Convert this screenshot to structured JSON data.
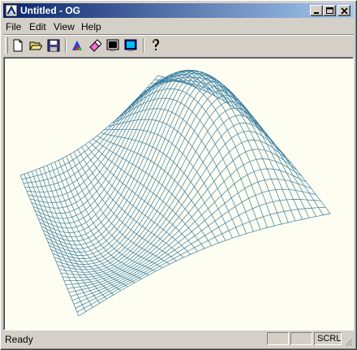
{
  "window": {
    "title": "Untitled - OG"
  },
  "menu": [
    "File",
    "Edit",
    "View",
    "Help"
  ],
  "toolbar": {
    "buttons": [
      {
        "name": "new-document-icon"
      },
      {
        "name": "open-folder-icon"
      },
      {
        "name": "save-disk-icon"
      },
      {
        "name": "color-palette-icon"
      },
      {
        "name": "eraser-icon"
      },
      {
        "name": "monitor-black-icon"
      },
      {
        "name": "monitor-cyan-icon"
      },
      {
        "name": "help-question-icon"
      }
    ]
  },
  "surface": {
    "type": "wireframe-surface",
    "line_color": "#3a7ea0"
  },
  "status": {
    "text": "Ready",
    "panes": [
      "",
      "",
      "SCRL"
    ]
  },
  "colors": {
    "title_start": "#0a246a",
    "title_end": "#a6caf0",
    "client_bg": "#fdfdf2",
    "chrome": "#d4d0c8"
  }
}
